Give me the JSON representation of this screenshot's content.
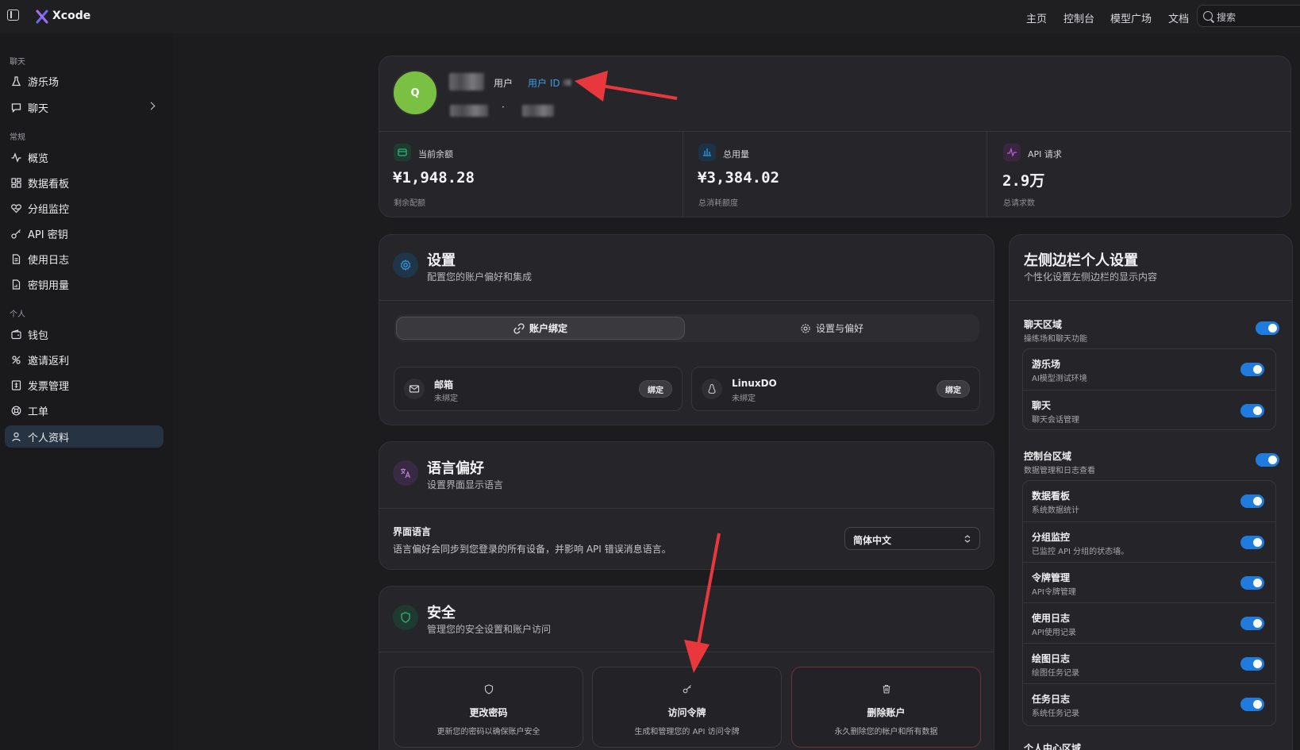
{
  "topbar": {
    "brand": "Xcode",
    "nav": [
      "主页",
      "控制台",
      "模型广场",
      "文档"
    ],
    "search_placeholder": "搜索"
  },
  "sidebar": {
    "sections": [
      {
        "title": "聊天",
        "items": [
          {
            "label": "游乐场",
            "icon": "flask-icon"
          },
          {
            "label": "聊天",
            "icon": "chat-icon",
            "expandable": true
          }
        ]
      },
      {
        "title": "常规",
        "items": [
          {
            "label": "概览",
            "icon": "activity-icon"
          },
          {
            "label": "数据看板",
            "icon": "dashboard-icon"
          },
          {
            "label": "分组监控",
            "icon": "heart-monitor-icon"
          },
          {
            "label": "API 密钥",
            "icon": "key-icon"
          },
          {
            "label": "使用日志",
            "icon": "document-icon"
          },
          {
            "label": "密钥用量",
            "icon": "document-chart-icon"
          }
        ]
      },
      {
        "title": "个人",
        "items": [
          {
            "label": "钱包",
            "icon": "wallet-icon"
          },
          {
            "label": "邀请返利",
            "icon": "gift-icon"
          },
          {
            "label": "发票管理",
            "icon": "invoice-icon"
          },
          {
            "label": "工单",
            "icon": "lifebuoy-icon"
          },
          {
            "label": "个人资料",
            "icon": "user-icon",
            "active": true
          }
        ]
      }
    ]
  },
  "profile": {
    "avatar_letter": "Q",
    "role": "用户",
    "user_id_label": "用户 ID",
    "separator": "·"
  },
  "stats": [
    {
      "label": "当前余额",
      "value": "¥1,948.28",
      "sub": "剩余配额",
      "icon": "wallet-icon",
      "color": "#2fb37c"
    },
    {
      "label": "总用量",
      "value": "¥3,384.02",
      "sub": "总消耗额度",
      "icon": "bar-chart-icon",
      "color": "#2f8fd6"
    },
    {
      "label": "API 请求",
      "value": "2.9万",
      "sub": "总请求数",
      "icon": "pulse-icon",
      "color": "#b45fc9"
    }
  ],
  "settings": {
    "title": "设置",
    "subtitle": "配置您的账户偏好和集成",
    "tabs": [
      {
        "label": "账户绑定",
        "active": true
      },
      {
        "label": "设置与偏好",
        "active": false
      }
    ],
    "bindings": [
      {
        "name": "邮箱",
        "status": "未绑定",
        "button": "绑定",
        "icon": "mail-icon"
      },
      {
        "name": "LinuxDO",
        "status": "未绑定",
        "button": "绑定",
        "icon": "linux-icon"
      }
    ]
  },
  "language": {
    "title": "语言偏好",
    "subtitle": "设置界面显示语言",
    "field_label": "界面语言",
    "field_desc": "语言偏好会同步到您登录的所有设备，并影响 API 错误消息语言。",
    "selected": "简体中文"
  },
  "security": {
    "title": "安全",
    "subtitle": "管理您的安全设置和账户访问",
    "cards": [
      {
        "title": "更改密码",
        "desc": "更新您的密码以确保账户安全",
        "icon": "shield-icon"
      },
      {
        "title": "访问令牌",
        "desc": "生成和管理您的 API 访问令牌",
        "icon": "key-icon"
      },
      {
        "title": "删除账户",
        "desc": "永久删除您的帐户和所有数据",
        "icon": "trash-icon"
      }
    ]
  },
  "sidebar_settings": {
    "title": "左侧边栏个人设置",
    "subtitle": "个性化设置左侧边栏的显示内容",
    "groups": [
      {
        "title": "聊天区域",
        "sub": "操练场和聊天功能",
        "enabled": true,
        "items": [
          {
            "name": "游乐场",
            "desc": "AI模型测试环境",
            "enabled": true
          },
          {
            "name": "聊天",
            "desc": "聊天会话管理",
            "enabled": true
          }
        ]
      },
      {
        "title": "控制台区域",
        "sub": "数据管理和日志查看",
        "enabled": true,
        "items": [
          {
            "name": "数据看板",
            "desc": "系统数据统计",
            "enabled": true
          },
          {
            "name": "分组监控",
            "desc": "已监控 API 分组的状态墙。",
            "enabled": true
          },
          {
            "name": "令牌管理",
            "desc": "API令牌管理",
            "enabled": true
          },
          {
            "name": "使用日志",
            "desc": "API使用记录",
            "enabled": true
          },
          {
            "name": "绘图日志",
            "desc": "绘图任务记录",
            "enabled": true
          },
          {
            "name": "任务日志",
            "desc": "系统任务记录",
            "enabled": true
          }
        ]
      },
      {
        "title": "个人中心区域"
      }
    ]
  },
  "colors": {
    "accent": "#1f7cde",
    "annotation_arrow": "#e8383d",
    "avatar": "#7ac143"
  }
}
